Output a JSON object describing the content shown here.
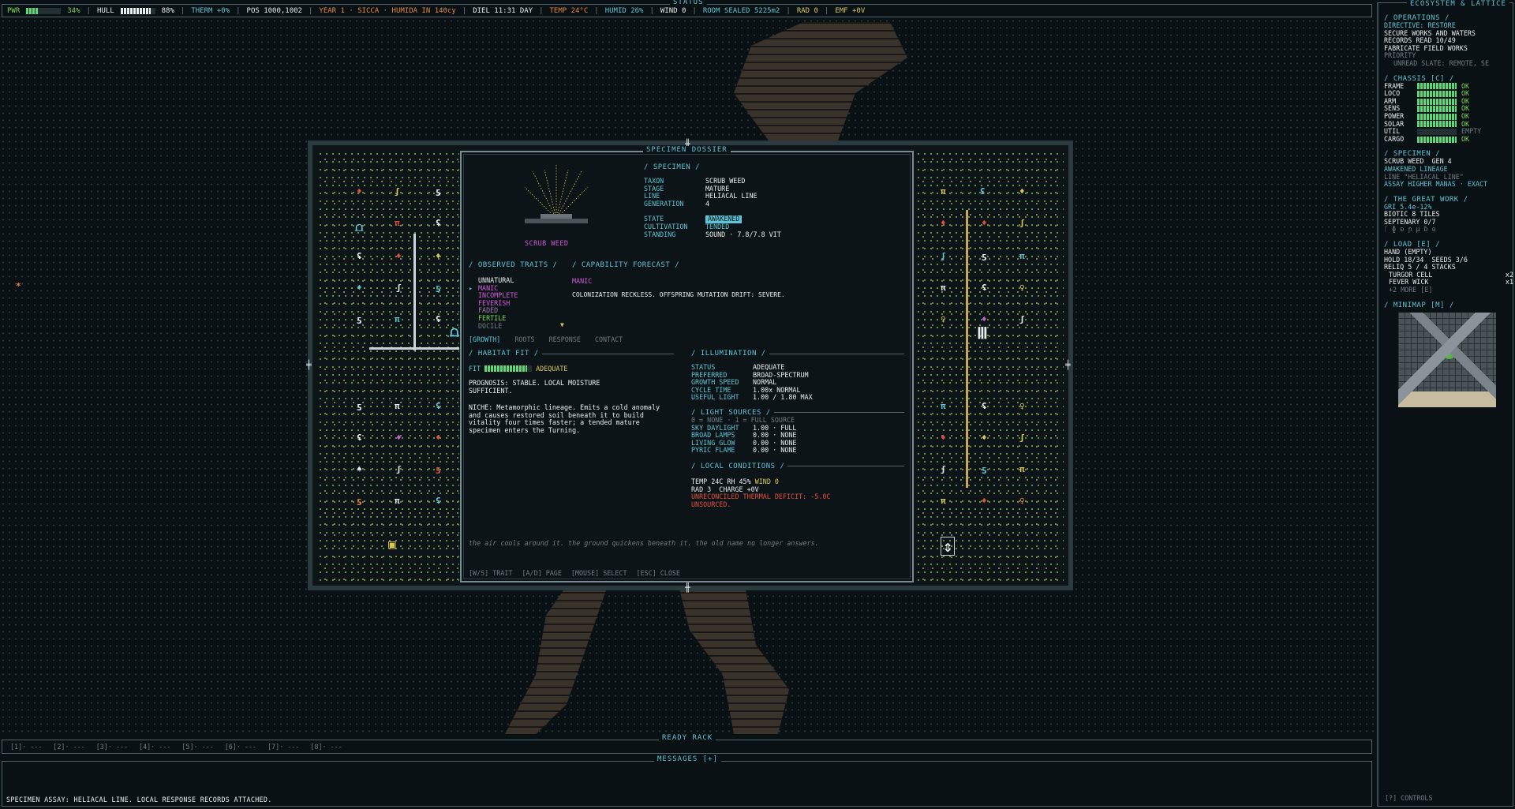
{
  "status": {
    "title": "STATUS",
    "pwr_label": "PWR",
    "pwr_value": "34%",
    "pwr_fill": 0.34,
    "hull_label": "HULL",
    "hull_value": "88%",
    "hull_fill": 0.88,
    "therm": "THERM +0%",
    "pos": "POS 1000,1002",
    "year": "YEAR 1 · SICCA · HUMIDA IN 140cy",
    "diel": "DIEL 11:31 DAY",
    "temp": "TEMP 24°C",
    "humid": "HUMID 26%",
    "wind": "WIND 0",
    "room": "ROOM SEALED 5225m2",
    "rad": "RAD 0",
    "emf": "EMF +0V"
  },
  "sidebar": {
    "title": "ECOSYSTEM & LATTICE",
    "operations": {
      "header": "/ OPERATIONS /",
      "directive": "DIRECTIVE: RESTORE",
      "items": [
        "SECURE WORKS AND WATERS",
        "RECORDS READ 10/49",
        "FABRICATE FIELD WORKS"
      ],
      "priority": "PRIORITY",
      "unread": "UNREAD SLATE: REMOTE, SE"
    },
    "chassis": {
      "header": "/ CHASSIS [C] /",
      "rows": [
        {
          "name": "FRAME",
          "fill": 1.0,
          "status": "OK"
        },
        {
          "name": "LOCO",
          "fill": 1.0,
          "status": "OK"
        },
        {
          "name": "ARM",
          "fill": 1.0,
          "status": "OK"
        },
        {
          "name": "SENS",
          "fill": 1.0,
          "status": "OK"
        },
        {
          "name": "POWER",
          "fill": 1.0,
          "status": "OK"
        },
        {
          "name": "SOLAR",
          "fill": 1.0,
          "status": "OK"
        },
        {
          "name": "UTIL",
          "fill": 0.0,
          "status": "EMPTY"
        },
        {
          "name": "CARGO",
          "fill": 1.0,
          "status": "OK"
        }
      ]
    },
    "specimen": {
      "header": "/ SPECIMEN /",
      "name": "SCRUB WEED",
      "gen": "GEN 4",
      "lineage": "AWAKENED LINEAGE",
      "line": "LINE \"HELIACAL LINE\"",
      "assay": "ASSAY HIGHER MANAS · EXACT"
    },
    "great_work": {
      "header": "/ THE GREAT WORK /",
      "gri": "GRI 5.4e-12%",
      "biotic": "BIOTIC 8 TILES",
      "septenary": "SEPTENARY 0/7",
      "glyphs": "ᚴ ɸ ʘ ɲ μ ɓ ʘ"
    },
    "load": {
      "header": "/ LOAD [E] /",
      "hand": "HAND (EMPTY)",
      "hold": "HOLD 18/34",
      "seeds": "SEEDS 3/6",
      "reliq": "RELIQ 5 / 4 STACKS",
      "items": [
        {
          "name": "TURGOR CELL",
          "qty": "x2"
        },
        {
          "name": "FEVER WICK",
          "qty": "x1"
        }
      ],
      "more": "+2 MORE [E]"
    },
    "minimap": {
      "header": "/ MINIMAP [M] /"
    },
    "controls": "[?] CONTROLS"
  },
  "dossier": {
    "title": "SPECIMEN DOSSIER",
    "plant_caption": "SCRUB WEED",
    "specimen_header": "/ SPECIMEN /",
    "fields": [
      {
        "k": "TAXON",
        "v": "SCRUB WEED"
      },
      {
        "k": "STAGE",
        "v": "MATURE"
      },
      {
        "k": "LINE",
        "v": "HELIACAL LINE"
      },
      {
        "k": "GENERATION",
        "v": "4"
      }
    ],
    "state_fields": [
      {
        "k": "STATE",
        "v": "AWAKENED"
      },
      {
        "k": "CULTIVATION",
        "v": "TENDED"
      },
      {
        "k": "STANDING",
        "v": "SOUND · 7.8/7.8 VIT"
      }
    ],
    "traits_header": "/ OBSERVED TRAITS /",
    "forecast_header": "/ CAPABILITY FORECAST /",
    "traits": [
      {
        "name": "UNNATURAL",
        "color": "#e8eef0"
      },
      {
        "name": "MANIC",
        "color": "#d05ad8",
        "selected": true
      },
      {
        "name": "INCOMPLETE",
        "color": "#d05ad8"
      },
      {
        "name": "FEVERISH",
        "color": "#d05ad8"
      },
      {
        "name": "FADED",
        "color": "#a07ca8"
      },
      {
        "name": "FERTILE",
        "color": "#7ad45a"
      },
      {
        "name": "DOCILE",
        "color": "#6d7d82"
      }
    ],
    "forecast_title": "MANIC",
    "forecast_text": "COLONIZATION RECKLESS. OFFSPRING MUTATION DRIFT: SEVERE.",
    "tabs": [
      "[GROWTH]",
      "ROOTS",
      "RESPONSE",
      "CONTACT"
    ],
    "habitat": {
      "header": "/ HABITAT FIT /",
      "fit_label": "FIT",
      "fit_fill": 0.9,
      "fit_value": "ADEQUATE",
      "prognosis": "PROGNOSIS: STABLE. LOCAL MOISTURE SUFFICIENT.",
      "niche": "NICHE: Metamorphic lineage. Emits a cold anomaly and causes restored soil beneath it to build vitality four times faster; a tended mature specimen enters the Turning."
    },
    "illumination": {
      "header": "/ ILLUMINATION /",
      "rows": [
        {
          "k": "STATUS",
          "v": "ADEQUATE"
        },
        {
          "k": "PREFERRED",
          "v": "BROAD-SPECTRUM"
        },
        {
          "k": "GROWTH SPEED",
          "v": "NORMAL"
        },
        {
          "k": "CYCLE TIME",
          "v": "1.00x NORMAL"
        },
        {
          "k": "USEFUL LIGHT",
          "v": "1.00 / 1.80 MAX"
        }
      ]
    },
    "light_sources": {
      "header": "/ LIGHT SOURCES /",
      "legend": "0 = NONE · 1 = FULL SOURCE",
      "rows": [
        {
          "k": "SKY DAYLIGHT",
          "v": "1.00 · FULL"
        },
        {
          "k": "BROAD LAMPS",
          "v": "0.00 · NONE"
        },
        {
          "k": "LIVING GLOW",
          "v": "0.00 · NONE"
        },
        {
          "k": "PYRIC FLAME",
          "v": "0.00 · NONE"
        }
      ]
    },
    "local": {
      "header": "/ LOCAL CONDITIONS /",
      "line1_temp": "TEMP 24C",
      "line1_rh": "RH 45%",
      "line1_wind": "WIND 0",
      "line2": "RAD 3  CHARGE +0V",
      "warning": "UNRECONCILED THERMAL DEFICIT: -5.0C",
      "warning2": "UNSOURCED."
    },
    "flavor": "the air cools around it. the ground quickens beneath it. the old name no longer answers.",
    "keys": [
      "[W/S] TRAIT",
      "[A/D] PAGE",
      "[MOUSE] SELECT",
      "[ESC] CLOSE"
    ]
  },
  "ready_rack": {
    "title": "READY RACK",
    "slots": [
      "[1]· ---",
      "[2]· ---",
      "[3]· ---",
      "[4]· ---",
      "[5]· ---",
      "[6]· ---",
      "[7]· ---",
      "[8]· ---"
    ]
  },
  "messages": {
    "title": "MESSAGES [+]",
    "last": "SPECIMEN ASSAY: HELIACAL LINE. LOCAL RESPONSE RECORDS ATTACHED."
  }
}
